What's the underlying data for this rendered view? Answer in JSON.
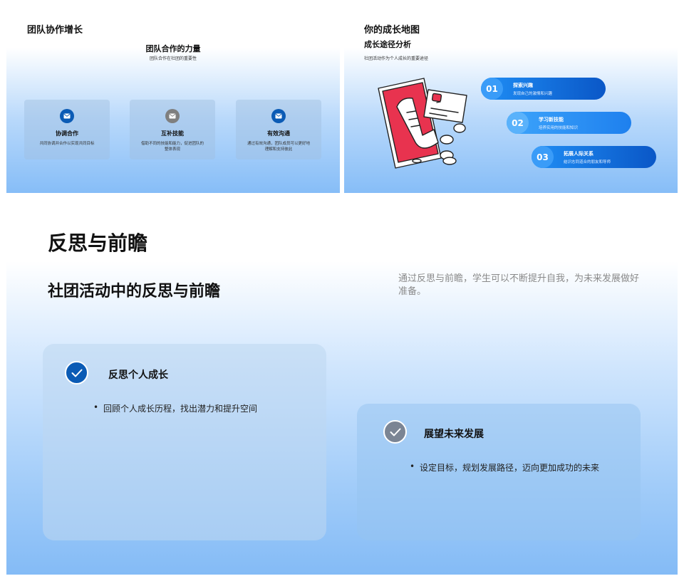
{
  "slide1": {
    "title": "团队协作增长",
    "subtitle": "团队合作的力量",
    "caption": "团队合作在社团的重要性",
    "cards": [
      {
        "icon": "envelope-icon",
        "icon_color": "#0b5bb5",
        "title": "协调合作",
        "desc": "共同协调并合作以实现共同目标"
      },
      {
        "icon": "envelope-icon",
        "icon_color": "#7f7f7f",
        "title": "互补技能",
        "desc": "借助不同的技能和能力，促进团队的整体表现"
      },
      {
        "icon": "envelope-icon",
        "icon_color": "#0b5bb5",
        "title": "有效沟通",
        "desc": "通过有效沟通，团队成员可以更好地理解和支持彼此"
      }
    ]
  },
  "slide2": {
    "title": "你的成长地图",
    "subtitle": "成长途径分析",
    "caption": "社团活动作为个人成长的重要途径",
    "steps": [
      {
        "num": "01",
        "title": "探索兴趣",
        "desc": "发现自己的激情和兴趣"
      },
      {
        "num": "02",
        "title": "学习新技能",
        "desc": "培养实用的技能和知识"
      },
      {
        "num": "03",
        "title": "拓展人际关系",
        "desc": "结识志同道合的朋友和导师"
      }
    ]
  },
  "slide3": {
    "title": "反思与前瞻",
    "subtitle": "社团活动中的反思与前瞻",
    "description": "通过反思与前瞻，学生可以不断提升自我，为未来发展做好准备。",
    "cards": [
      {
        "icon": "checkmark-icon",
        "icon_color": "#0b5bb5",
        "title": "反思个人成长",
        "item": "回顾个人成长历程，找出潜力和提升空间"
      },
      {
        "icon": "checkmark-icon",
        "icon_color": "#7b8594",
        "title": "展望未来发展",
        "item": "设定目标，规划发展路径，迈向更加成功的未来"
      }
    ]
  },
  "colors": {
    "accent": "#0b5bb5",
    "pill_start": "#1f8ef5",
    "pill_end": "#0a57c7",
    "phone_red": "#e8334f"
  }
}
